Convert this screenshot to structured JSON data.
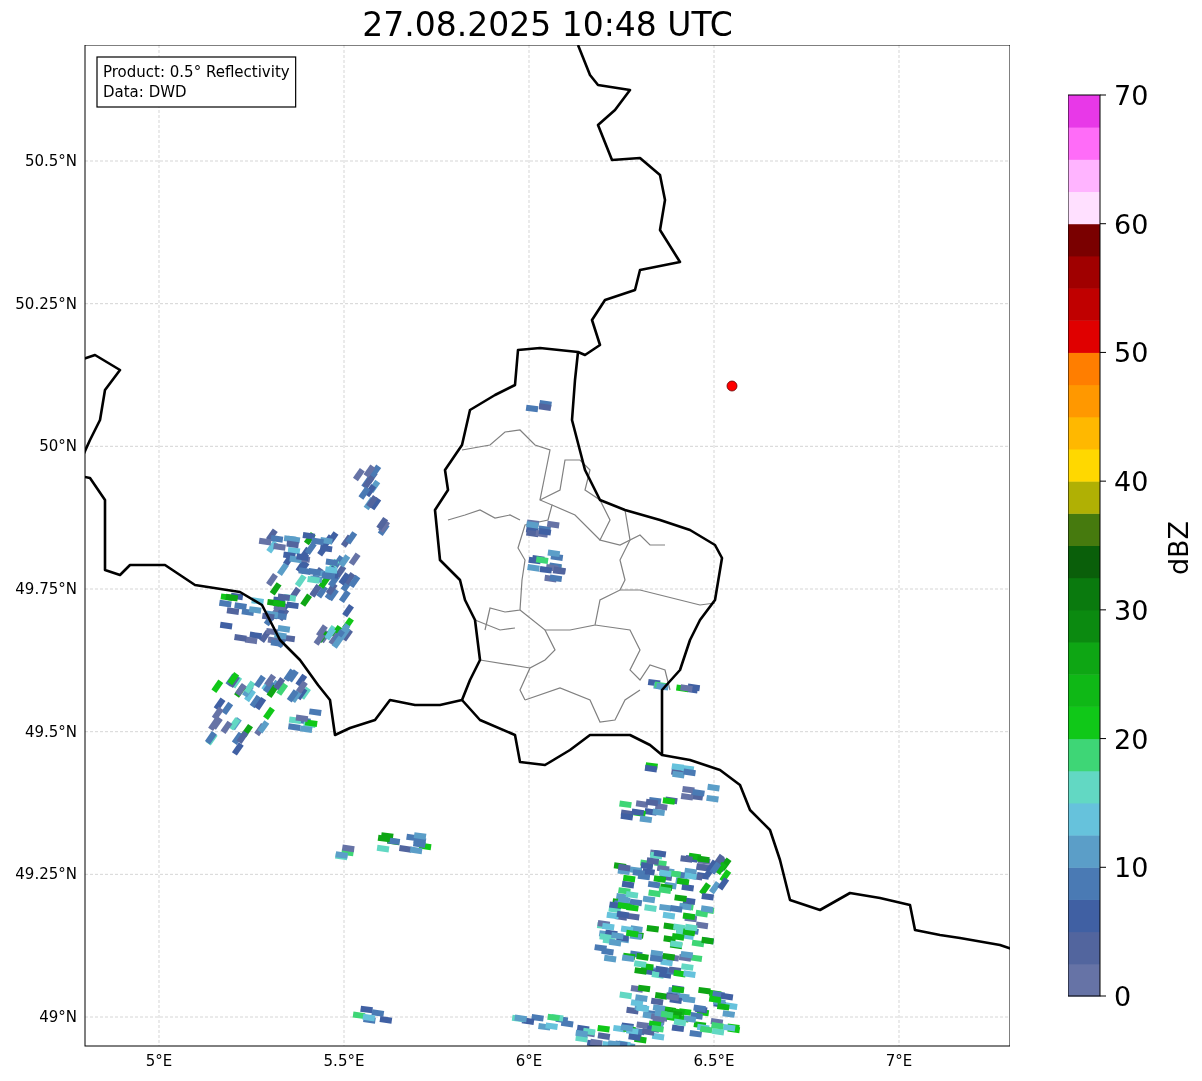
{
  "title": "27.08.2025 10:48 UTC",
  "legend": {
    "lines": [
      "Product: 0.5° Reflectivity",
      "Data: DWD"
    ]
  },
  "map": {
    "lat_labels": [
      "50.5°N",
      "50.25°N",
      "50°N",
      "49.75°N",
      "49.5°N",
      "49.25°N",
      "49°N"
    ],
    "lon_labels": [
      "5°E",
      "5.5°E",
      "6°E",
      "6.5°E",
      "7°E"
    ]
  },
  "colorbar": {
    "label": "dBZ",
    "tick_labels": [
      "70",
      "60",
      "50",
      "40",
      "30",
      "20",
      "10",
      "0"
    ],
    "segments": [
      {
        "color": "#6673a6"
      },
      {
        "color": "#52659e"
      },
      {
        "color": "#4060a3"
      },
      {
        "color": "#4a7ab4"
      },
      {
        "color": "#5b9ec8"
      },
      {
        "color": "#66c2dc"
      },
      {
        "color": "#62d8c3"
      },
      {
        "color": "#3ed676"
      },
      {
        "color": "#10c818"
      },
      {
        "color": "#0fb816"
      },
      {
        "color": "#0ea614"
      },
      {
        "color": "#0b8a10"
      },
      {
        "color": "#0a7a0e"
      },
      {
        "color": "#0a5f0a"
      },
      {
        "color": "#467a0e"
      },
      {
        "color": "#b0b004"
      },
      {
        "color": "#ffd800"
      },
      {
        "color": "#ffb800"
      },
      {
        "color": "#ff9800"
      },
      {
        "color": "#ff7e00"
      },
      {
        "color": "#e00000"
      },
      {
        "color": "#c00000"
      },
      {
        "color": "#a00000"
      },
      {
        "color": "#7a0000"
      },
      {
        "color": "#ffe0ff"
      },
      {
        "color": "#ffb4ff"
      },
      {
        "color": "#ff6cf8"
      },
      {
        "color": "#e838e8"
      }
    ]
  }
}
